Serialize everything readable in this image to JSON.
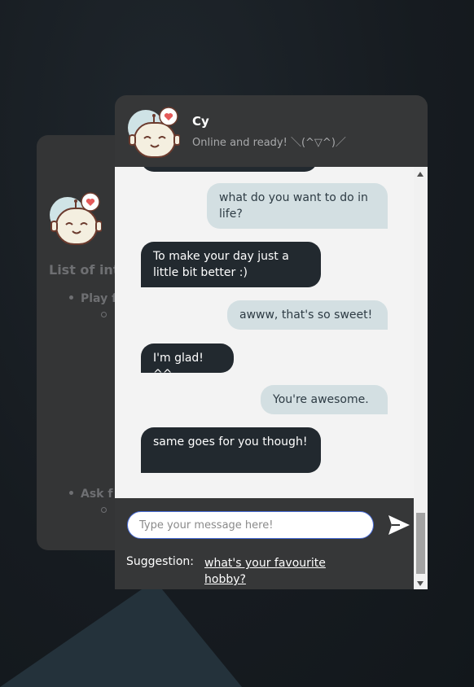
{
  "bot": {
    "name": "Cy",
    "status": "Online and ready! ＼(^▽^)／"
  },
  "info_panel": {
    "title": "List of int",
    "bullets": [
      "Play f",
      "Ask f"
    ]
  },
  "messages": [
    {
      "sender": "user",
      "text": "what do you want to do in life?"
    },
    {
      "sender": "bot",
      "text": "To make your day just a little bit better :)"
    },
    {
      "sender": "user",
      "text": "awww, that's so sweet!"
    },
    {
      "sender": "bot",
      "text": "I'm glad! ^^"
    },
    {
      "sender": "user",
      "text": "You're awesome."
    },
    {
      "sender": "bot",
      "text": "same goes for you though!"
    }
  ],
  "input": {
    "placeholder": "Type your message here!",
    "value": ""
  },
  "suggestion": {
    "label": "Suggestion:",
    "text": "what's your favourite hobby?"
  },
  "colors": {
    "page_bg": "#161b20",
    "panel_bg": "#363738",
    "bot_bubble": "#22292f",
    "user_bubble": "#d3dfe2",
    "heart": "#e55a5a",
    "avatar_circle": "#cfe3e6"
  }
}
